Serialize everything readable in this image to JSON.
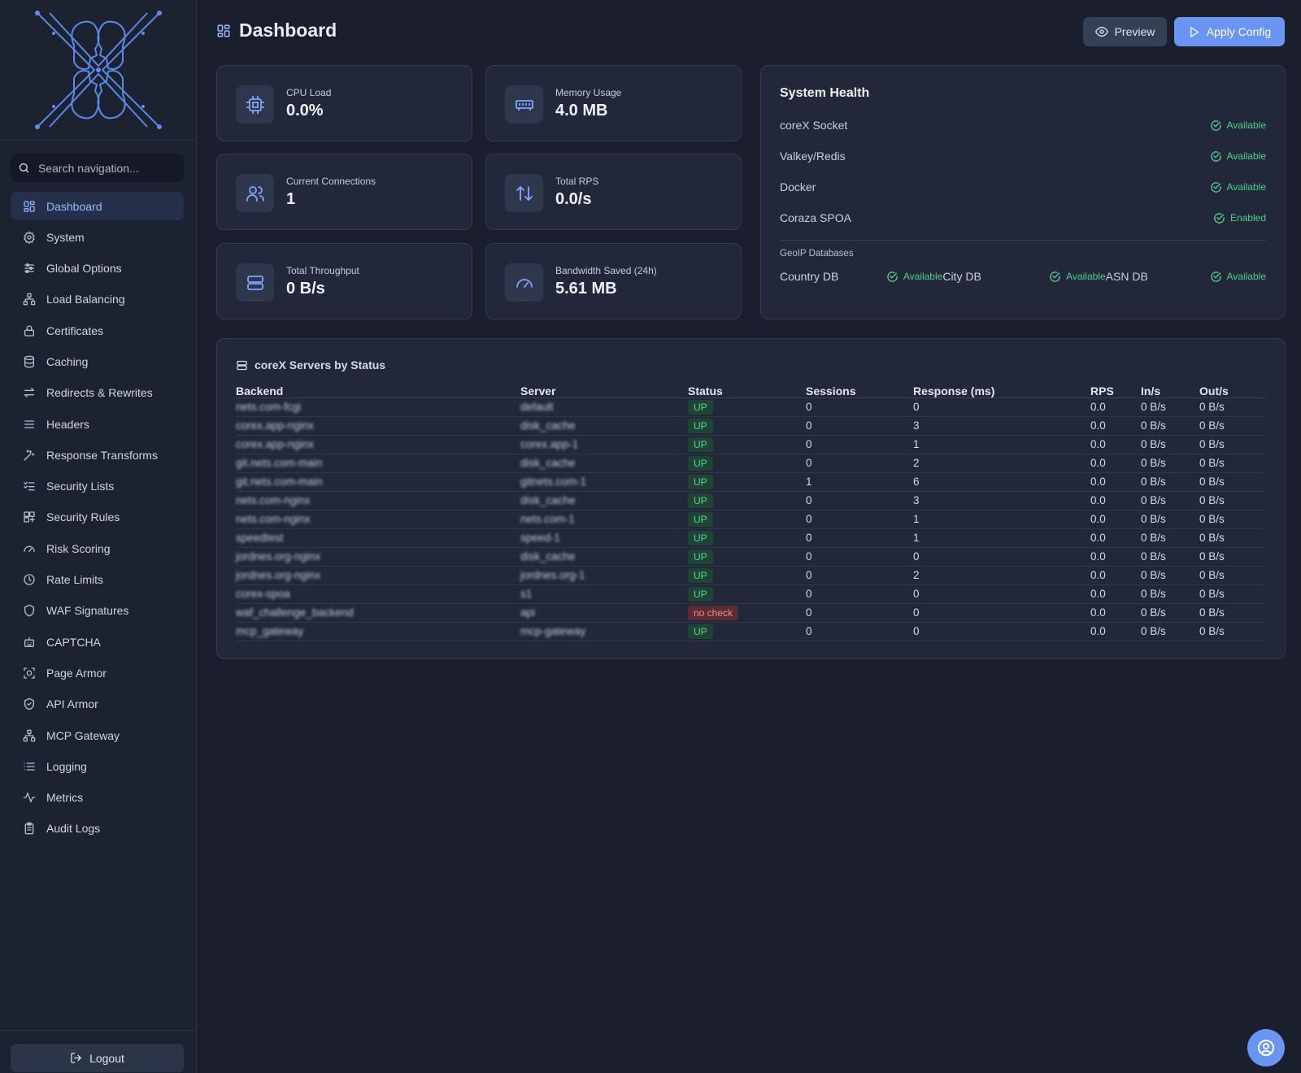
{
  "app": {
    "logo_alt": "coreX",
    "search": {
      "placeholder": "Search navigation..."
    },
    "logout_label": "Logout"
  },
  "sidebar": {
    "items": [
      {
        "label": "Dashboard",
        "icon": "grid-icon",
        "active": true
      },
      {
        "label": "System",
        "icon": "gear-icon"
      },
      {
        "label": "Global Options",
        "icon": "sliders-icon"
      },
      {
        "label": "Load Balancing",
        "icon": "network-icon"
      },
      {
        "label": "Certificates",
        "icon": "lock-icon"
      },
      {
        "label": "Caching",
        "icon": "database-icon"
      },
      {
        "label": "Redirects & Rewrites",
        "icon": "arrows-icon"
      },
      {
        "label": "Headers",
        "icon": "menu-icon"
      },
      {
        "label": "Response Transforms",
        "icon": "wand-icon"
      },
      {
        "label": "Security Lists",
        "icon": "checklist-icon"
      },
      {
        "label": "Security Rules",
        "icon": "rules-icon"
      },
      {
        "label": "Risk Scoring",
        "icon": "gauge-icon"
      },
      {
        "label": "Rate Limits",
        "icon": "clock-icon"
      },
      {
        "label": "WAF Signatures",
        "icon": "shield-icon"
      },
      {
        "label": "CAPTCHA",
        "icon": "robot-icon"
      },
      {
        "label": "Page Armor",
        "icon": "scan-icon"
      },
      {
        "label": "API Armor",
        "icon": "shield-check-icon"
      },
      {
        "label": "MCP Gateway",
        "icon": "network-icon"
      },
      {
        "label": "Logging",
        "icon": "list-icon"
      },
      {
        "label": "Metrics",
        "icon": "activity-icon"
      },
      {
        "label": "Audit Logs",
        "icon": "clipboard-icon"
      }
    ]
  },
  "header": {
    "title": "Dashboard",
    "preview_label": "Preview",
    "apply_label": "Apply Config"
  },
  "stats": {
    "cpu": {
      "label": "CPU Load",
      "value": "0.0%"
    },
    "memory": {
      "label": "Memory Usage",
      "value": "4.0 MB"
    },
    "connections": {
      "label": "Current Connections",
      "value": "1"
    },
    "rps": {
      "label": "Total RPS",
      "value": "0.0/s"
    },
    "throughput": {
      "label": "Total Throughput",
      "value": "0 B/s"
    },
    "bandwidth": {
      "label": "Bandwidth Saved (24h)",
      "value": "5.61 MB"
    }
  },
  "health": {
    "title": "System Health",
    "items": [
      {
        "name": "coreX Socket",
        "status": "Available"
      },
      {
        "name": "Valkey/Redis",
        "status": "Available"
      },
      {
        "name": "Docker",
        "status": "Available"
      },
      {
        "name": "Coraza SPOA",
        "status": "Enabled"
      }
    ],
    "geoip_label": "GeoIP Databases",
    "geoip": [
      {
        "name": "Country DB",
        "status": "Available"
      },
      {
        "name": "City DB",
        "status": "Available"
      },
      {
        "name": "ASN DB",
        "status": "Available"
      }
    ]
  },
  "servers": {
    "title": "coreX Servers by Status",
    "columns": [
      "Backend",
      "Server",
      "Status",
      "Sessions",
      "Response (ms)",
      "RPS",
      "In/s",
      "Out/s"
    ],
    "rows": [
      {
        "backend": "nets.com-fcgi",
        "server": "default",
        "status": "UP",
        "sessions": "0",
        "response": "0",
        "rps": "0.0",
        "in": "0 B/s",
        "out": "0 B/s"
      },
      {
        "backend": "corex.app-nginx",
        "server": "disk_cache",
        "status": "UP",
        "sessions": "0",
        "response": "3",
        "rps": "0.0",
        "in": "0 B/s",
        "out": "0 B/s"
      },
      {
        "backend": "corex.app-nginx",
        "server": "corex.app-1",
        "status": "UP",
        "sessions": "0",
        "response": "1",
        "rps": "0.0",
        "in": "0 B/s",
        "out": "0 B/s"
      },
      {
        "backend": "git.nets.com-main",
        "server": "disk_cache",
        "status": "UP",
        "sessions": "0",
        "response": "2",
        "rps": "0.0",
        "in": "0 B/s",
        "out": "0 B/s"
      },
      {
        "backend": "git.nets.com-main",
        "server": "gitnets.com-1",
        "status": "UP",
        "sessions": "1",
        "response": "6",
        "rps": "0.0",
        "in": "0 B/s",
        "out": "0 B/s"
      },
      {
        "backend": "nets.com-nginx",
        "server": "disk_cache",
        "status": "UP",
        "sessions": "0",
        "response": "3",
        "rps": "0.0",
        "in": "0 B/s",
        "out": "0 B/s"
      },
      {
        "backend": "nets.com-nginx",
        "server": "nets.com-1",
        "status": "UP",
        "sessions": "0",
        "response": "1",
        "rps": "0.0",
        "in": "0 B/s",
        "out": "0 B/s"
      },
      {
        "backend": "speedtest",
        "server": "speed-1",
        "status": "UP",
        "sessions": "0",
        "response": "1",
        "rps": "0.0",
        "in": "0 B/s",
        "out": "0 B/s"
      },
      {
        "backend": "jordnes.org-nginx",
        "server": "disk_cache",
        "status": "UP",
        "sessions": "0",
        "response": "0",
        "rps": "0.0",
        "in": "0 B/s",
        "out": "0 B/s"
      },
      {
        "backend": "jordnes.org-nginx",
        "server": "jordnes.org-1",
        "status": "UP",
        "sessions": "0",
        "response": "2",
        "rps": "0.0",
        "in": "0 B/s",
        "out": "0 B/s"
      },
      {
        "backend": "corex-spoa",
        "server": "s1",
        "status": "UP",
        "sessions": "0",
        "response": "0",
        "rps": "0.0",
        "in": "0 B/s",
        "out": "0 B/s"
      },
      {
        "backend": "waf_challenge_backend",
        "server": "api",
        "status": "no check",
        "sessions": "0",
        "response": "0",
        "rps": "0.0",
        "in": "0 B/s",
        "out": "0 B/s"
      },
      {
        "backend": "mcp_gateway",
        "server": "mcp-gateway",
        "status": "UP",
        "sessions": "0",
        "response": "0",
        "rps": "0.0",
        "in": "0 B/s",
        "out": "0 B/s"
      }
    ]
  },
  "colors": {
    "background": "#1a1e2d",
    "accent": "#6b95f2",
    "ok": "#4fcf8e",
    "danger": "#f08b94"
  }
}
